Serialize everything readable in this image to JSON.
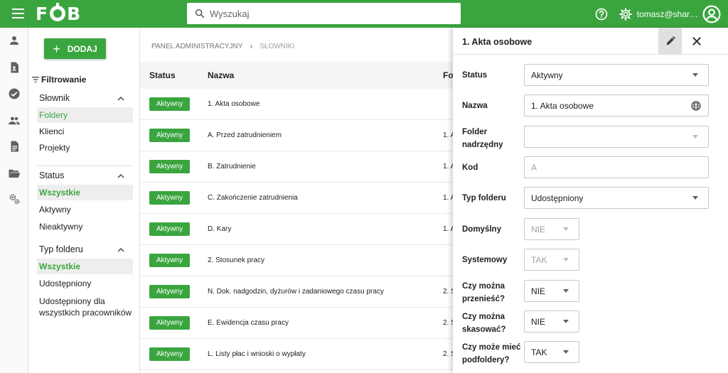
{
  "topbar": {
    "logo": "FOB",
    "search_placeholder": "Wyszukaj",
    "user": "tomasz@shar…"
  },
  "sidebar": {
    "add_label": "DODAJ",
    "filter_title": "Filtrowanie",
    "groups": [
      {
        "label": "Słownik",
        "options": [
          "Foldery",
          "Klienci",
          "Projekty"
        ]
      },
      {
        "label": "Status",
        "options": [
          "Wszystkie",
          "Aktywny",
          "Nieaktywny"
        ]
      },
      {
        "label": "Typ folderu",
        "options": [
          "Wszystkie",
          "Udostępniony",
          "Udostępniony dla wszystkich pracowników"
        ]
      }
    ]
  },
  "breadcrumb": {
    "root": "PANEL ADMINISTRACYJNY",
    "current": "SŁOWNIKI"
  },
  "table": {
    "headers": [
      "Status",
      "Nazwa",
      "Fo"
    ],
    "rows": [
      {
        "status": "Aktywny",
        "name": "1. Akta osobowe",
        "folder": ""
      },
      {
        "status": "Aktywny",
        "name": "A. Przed zatrudnieniem",
        "folder": "1. A"
      },
      {
        "status": "Aktywny",
        "name": "B. Zatrudnienie",
        "folder": "1. A"
      },
      {
        "status": "Aktywny",
        "name": "C. Zakończenie zatrudnienia",
        "folder": "1. A"
      },
      {
        "status": "Aktywny",
        "name": "D. Kary",
        "folder": "1. A"
      },
      {
        "status": "Aktywny",
        "name": "2. Stosunek pracy",
        "folder": ""
      },
      {
        "status": "Aktywny",
        "name": "N. Dok. nadgodzin, dyżurów i zadaniowego czasu pracy",
        "folder": "2. S"
      },
      {
        "status": "Aktywny",
        "name": "E. Ewidencja czasu pracy",
        "folder": "2. S"
      },
      {
        "status": "Aktywny",
        "name": "L. Listy płac i wnioski o wypłaty",
        "folder": "2. S"
      }
    ]
  },
  "panel": {
    "title": "1. Akta osobowe",
    "fields": {
      "status": {
        "label": "Status",
        "value": "Aktywny"
      },
      "name": {
        "label": "Nazwa",
        "value": "1. Akta osobowe"
      },
      "parent": {
        "label": "Folder nadrzędny",
        "value": ""
      },
      "code": {
        "label": "Kod",
        "value": "A"
      },
      "type": {
        "label": "Typ folderu",
        "value": "Udostępniony"
      },
      "default": {
        "label": "Domyślny",
        "value": "NIE"
      },
      "system": {
        "label": "Systemowy",
        "value": "TAK"
      },
      "movable": {
        "label": "Czy można przenieść?",
        "value": "NIE"
      },
      "deletable": {
        "label": "Czy można skasować?",
        "value": "NIE"
      },
      "subfolders": {
        "label": "Czy może mieć podfoldery?",
        "value": "TAK"
      }
    }
  },
  "colors": {
    "accent": "#3aa53f"
  }
}
